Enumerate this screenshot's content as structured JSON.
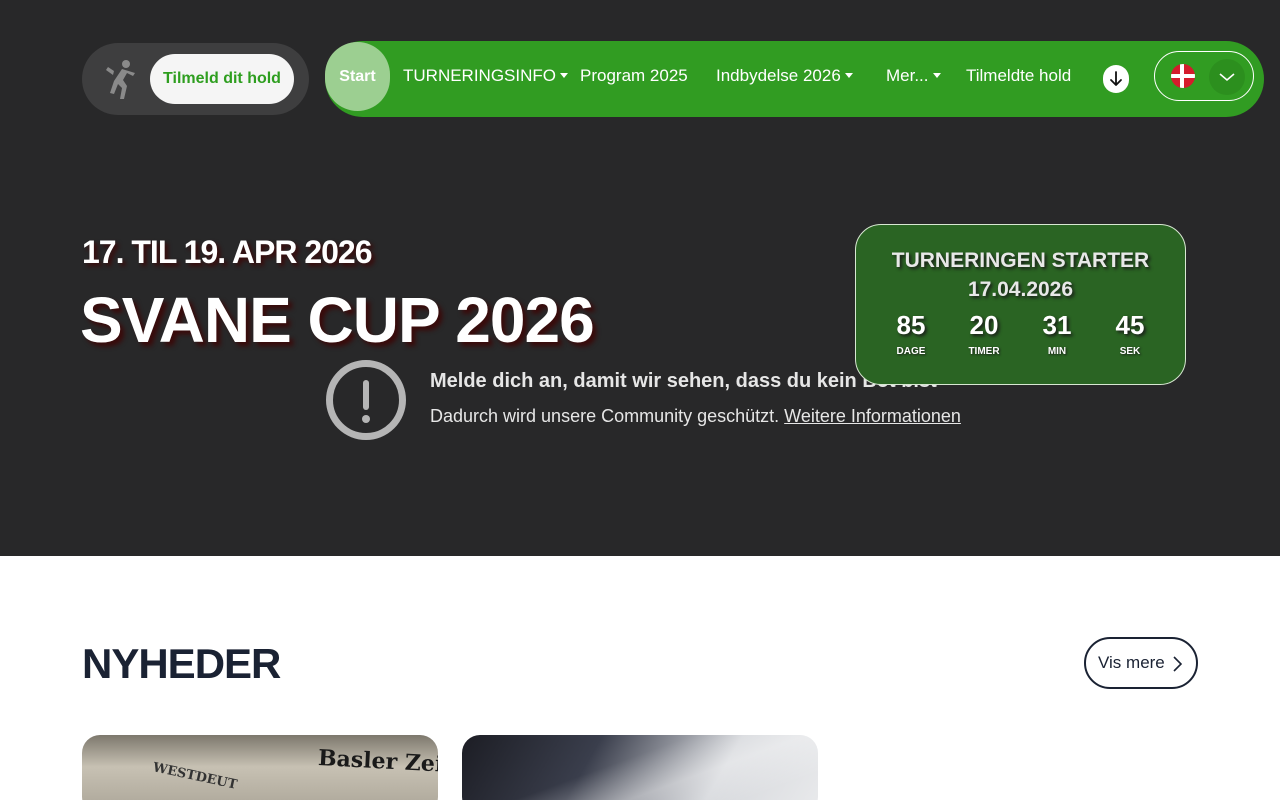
{
  "brand": {
    "register_label": "Tilmeld dit hold",
    "logo_icon": "handball-player-icon"
  },
  "nav": {
    "start": "Start",
    "items": [
      {
        "label": "TURNERINGSINFO",
        "dropdown": true
      },
      {
        "label": "Program 2025",
        "dropdown": false
      },
      {
        "label": "Indbydelse 2026",
        "dropdown": true
      },
      {
        "label": "Mer...",
        "dropdown": true
      },
      {
        "label": "Tilmeldte hold",
        "dropdown": false
      }
    ],
    "download_icon": "arrow-down-icon",
    "language_flag": "denmark-flag-icon",
    "accent_color": "#319c22"
  },
  "hero": {
    "date": "17. TIL 19. APR 2026",
    "title": "SVANE CUP 2026",
    "background_color": "#282829"
  },
  "countdown": {
    "title_line1": "TURNERINGEN STARTER",
    "title_line2": "17.04.2026",
    "units": [
      {
        "value": "85",
        "label": "DAGE"
      },
      {
        "value": "20",
        "label": "TIMER"
      },
      {
        "value": "31",
        "label": "MIN"
      },
      {
        "value": "45",
        "label": "SEK"
      }
    ]
  },
  "bot_notice": {
    "heading": "Melde dich an, damit wir sehen, dass du kein Bot bist",
    "text": "Dadurch wird unsere Community geschützt.",
    "link": "Weitere Informationen"
  },
  "news": {
    "heading": "NYHEDER",
    "more_label": "Vis mere",
    "cards": [
      {
        "image": "newspapers-stand-image",
        "visible_text_1": "Basler Zeitu",
        "visible_text_2": "WESTDEUT"
      },
      {
        "image": "magazine-pages-image"
      }
    ]
  }
}
